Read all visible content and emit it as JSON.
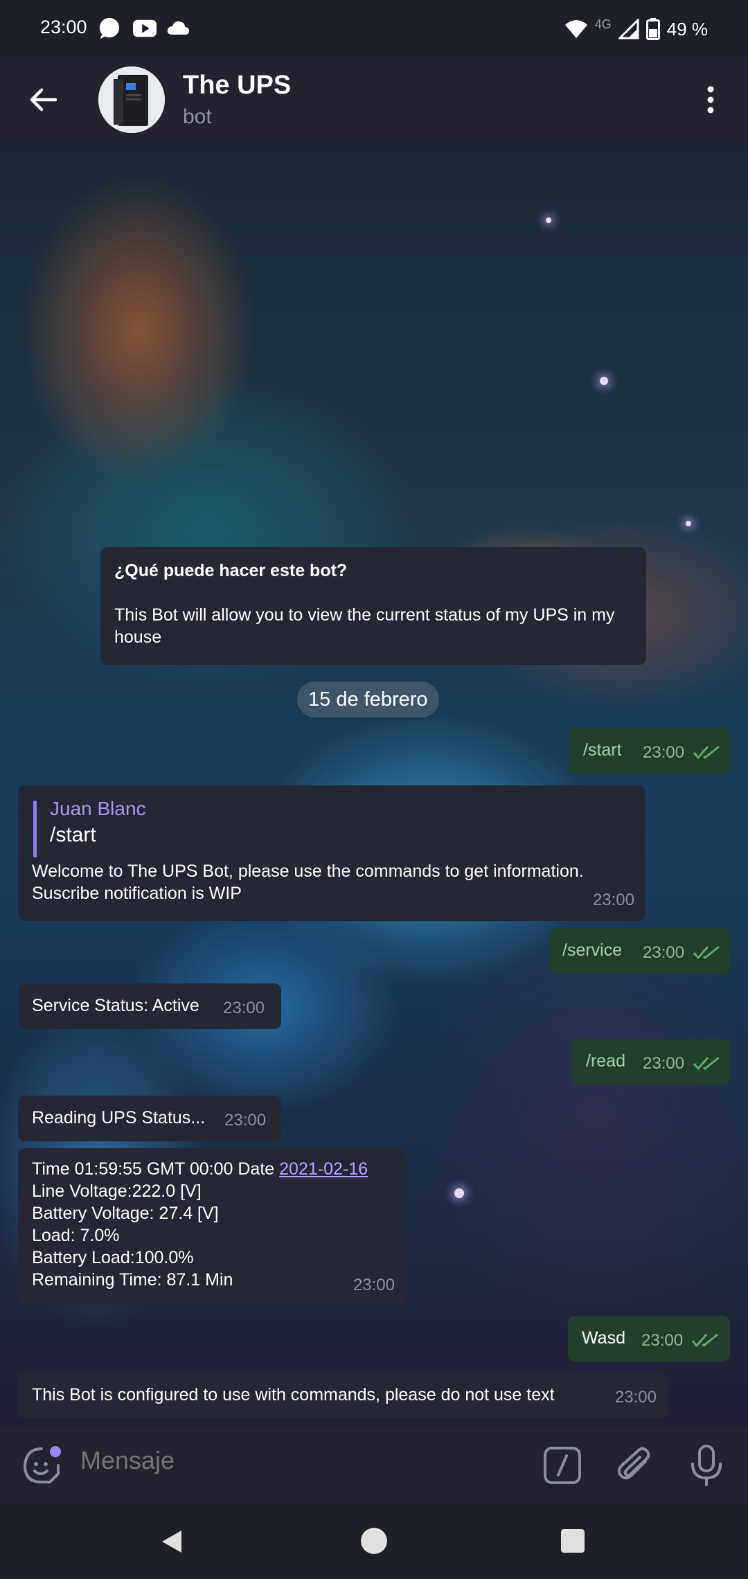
{
  "status_bar": {
    "time": "23:00",
    "network": "4G",
    "battery": "49 %",
    "notification_icons": [
      "chat-bubble-icon",
      "youtube-icon",
      "cloud-icon"
    ],
    "right_icons": [
      "wifi-icon",
      "signal-icon",
      "battery-icon"
    ]
  },
  "header": {
    "title": "The UPS",
    "subtitle": "bot",
    "avatar": "ups-device-avatar"
  },
  "bot_info": {
    "title": "¿Qué puede hacer este bot?",
    "text": "This Bot will allow you to view the current status of my UPS in my house"
  },
  "date_separator": "15 de febrero",
  "messages": [
    {
      "direction": "out",
      "text": "/start",
      "time": "23:00"
    },
    {
      "direction": "in",
      "reply_author": "Juan Blanc",
      "reply_text": "/start",
      "line1": "Welcome to The UPS Bot, please use the commands to get information.",
      "line2": "Suscribe notification is WIP",
      "time": "23:00"
    },
    {
      "direction": "out",
      "text": "/service",
      "time": "23:00"
    },
    {
      "direction": "in",
      "text": "Service Status: Active",
      "time": "23:00"
    },
    {
      "direction": "out",
      "text": "/read",
      "time": "23:00"
    },
    {
      "direction": "in",
      "text": "Reading UPS Status...",
      "time": "23:00"
    },
    {
      "direction": "in",
      "line1_prefix": "Time 01:59:55 GMT 00:00 Date ",
      "line1_link": "2021-02-16",
      "line2": "Line Voltage:222.0 [V]",
      "line3": "Battery Voltage: 27.4 [V]",
      "line4": "Load: 7.0%",
      "line5": "Battery Load:100.0%",
      "line6": "Remaining Time: 87.1 Min",
      "time": "23:00"
    },
    {
      "direction": "out",
      "text": "Wasd",
      "time": "23:00"
    },
    {
      "direction": "in",
      "text": "This Bot is configured to use with commands, please do not use text",
      "time": "23:00"
    }
  ],
  "input": {
    "placeholder": "Mensaje"
  },
  "colors": {
    "header_bg": "#22232e",
    "incoming_bubble": "#262734",
    "outgoing_bubble": "#233f2c",
    "accent": "#8e7cf0"
  }
}
